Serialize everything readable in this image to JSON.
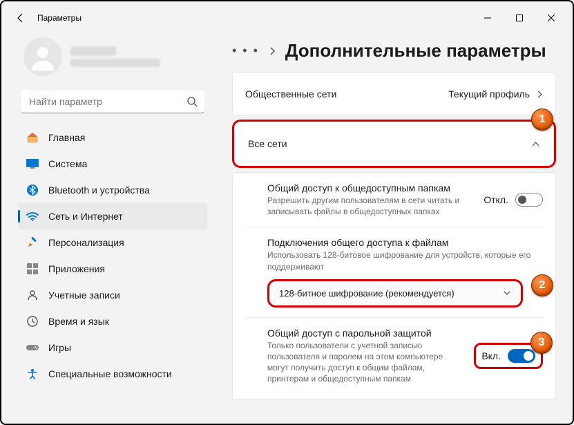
{
  "titlebar": {
    "title": "Параметры"
  },
  "search": {
    "placeholder": "Найти параметр"
  },
  "nav": {
    "home": "Главная",
    "system": "Система",
    "bluetooth": "Bluetooth и устройства",
    "network": "Сеть и Интернет",
    "personalization": "Персонализация",
    "apps": "Приложения",
    "accounts": "Учетные записи",
    "time": "Время и язык",
    "gaming": "Игры",
    "accessibility": "Специальные возможности"
  },
  "breadcrumb": {
    "dots": "• • •",
    "title": "Дополнительные параметры"
  },
  "cards": {
    "public": {
      "label": "Общественные сети",
      "right": "Текущий профиль"
    },
    "all": {
      "label": "Все сети"
    }
  },
  "settings": {
    "sharing": {
      "title": "Общий доступ к общедоступным папкам",
      "desc": "Разрешить другим пользователям в сети читать и записывать файлы в общедоступных папках",
      "state": "Откл."
    },
    "encryption": {
      "title": "Подключения общего доступа к файлам",
      "desc": "Использовать 128-битовое шифрование для устройств, которые его поддерживают",
      "selected": "128-битное шифрование (рекомендуется)"
    },
    "password": {
      "title": "Общий доступ с парольной защитой",
      "desc": "Только пользователи с учетной записью пользователя и паролем на этом компьютере могут получить доступ к общим файлам, принтерам и общедоступным папкам",
      "state": "Вкл."
    }
  },
  "annotations": {
    "b1": "1",
    "b2": "2",
    "b3": "3"
  }
}
